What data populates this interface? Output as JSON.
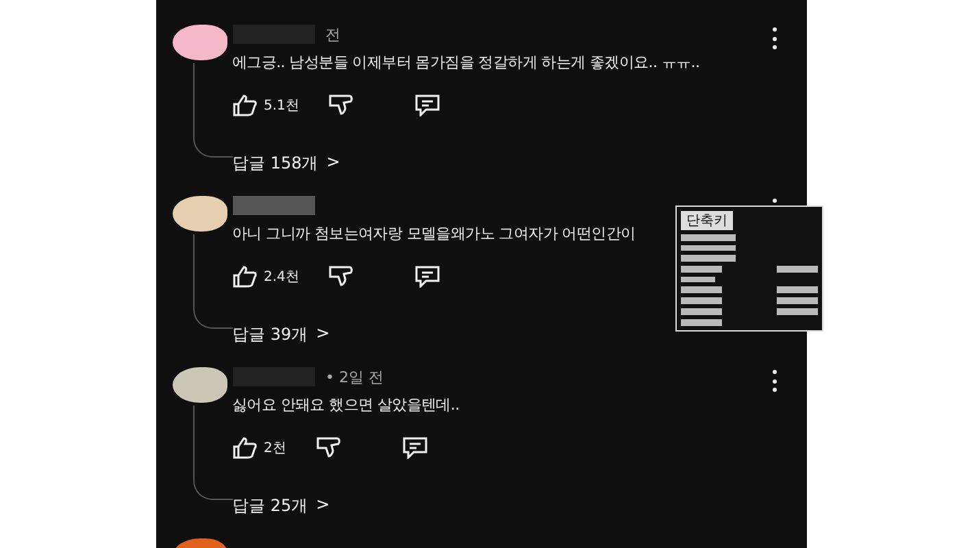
{
  "comments": [
    {
      "color": "#f4b8c8",
      "meta": "전",
      "text": "에그긍.. 남성분들 이제부터 몸가짐을 정갈하게 하는게 좋겠이요.. ㅠㅠ..",
      "likes": "5.1천",
      "replies": "답글 158개",
      "chevron": ">"
    },
    {
      "color": "#e6cfae",
      "text": "아니 그니까 첨보는여자랑 모델을왜가노 그여자가 어떤인간이",
      "likes": "2.4천",
      "replies": "답글 39개",
      "chevron": ">"
    },
    {
      "color": "#cbc6b6",
      "meta": "• 2일 전",
      "text": "싫어요 안돼요 했으면 살았을텐데..",
      "likes": "2천",
      "replies": "답글 25개",
      "chevron": ">"
    },
    {
      "color": "#e0601e"
    }
  ],
  "shortcut_panel": {
    "title": "단축키"
  }
}
